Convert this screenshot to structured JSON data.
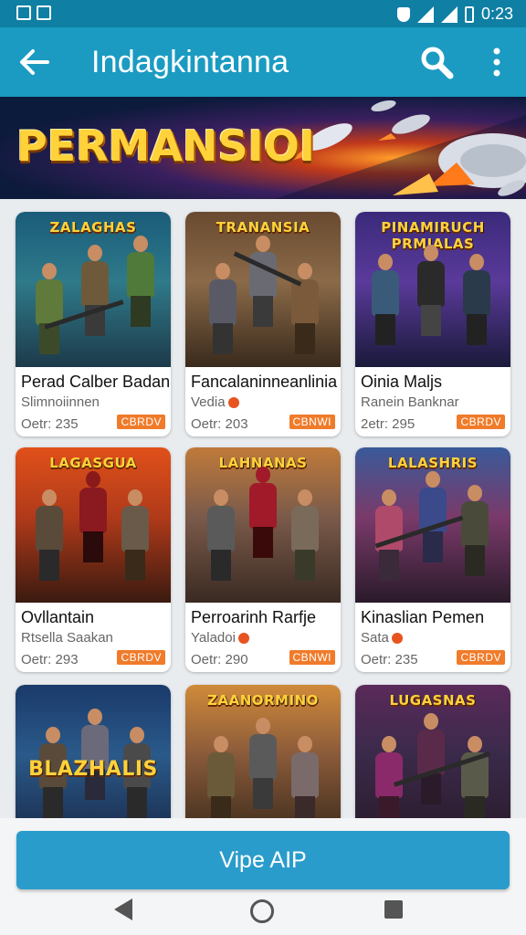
{
  "status": {
    "time": "0:23"
  },
  "appbar": {
    "title": "Indagkintanna",
    "back_icon": "back-arrow-icon",
    "search_icon": "search-icon",
    "more_icon": "more-vert-icon"
  },
  "banner": {
    "text": "PERMANSIOI"
  },
  "colors": {
    "appbar": "#1b9bc2",
    "statusbar": "#0f7fa3",
    "cta": "#2a9ccc",
    "badge": "#f07b2a"
  },
  "cards": [
    {
      "art_title": "ZALAGHAS",
      "name": "Perad Calber Badan",
      "sub": "Slimnoiinnen",
      "sub_dot": false,
      "cost": "Oetr: 235",
      "button": "CBRDV"
    },
    {
      "art_title": "TRANANSIA",
      "name": "Fancalaninneanlinia",
      "sub": "Vedia",
      "sub_dot": true,
      "cost": "Oetr: 203",
      "button": "CBNWI"
    },
    {
      "art_title": "PINAMIRUCH PRMIALAS",
      "name": "Oinia Maljs",
      "sub": "Ranein Banknar",
      "sub_dot": false,
      "cost": "2etr: 295",
      "button": "CBRDV"
    },
    {
      "art_title": "LAGASGUA",
      "name": "Ovllantain",
      "sub": "Rtsella Saakan",
      "sub_dot": false,
      "cost": "Oetr: 293",
      "button": "CBRDV"
    },
    {
      "art_title": "LAHNANAS",
      "name": "Perroarinh Rarfje",
      "sub": "Yaladoi",
      "sub_dot": true,
      "cost": "Oetr: 290",
      "button": "CBNWI"
    },
    {
      "art_title": "LALASHRIS",
      "name": "Kinaslian Pemen",
      "sub": "Sata",
      "sub_dot": true,
      "cost": "Oetr: 235",
      "button": "CBRDV"
    },
    {
      "art_title": "",
      "name": "",
      "sub": "",
      "sub_dot": false,
      "cost": "",
      "button": ""
    },
    {
      "art_title": "ZAANORMINO",
      "name": "",
      "sub": "",
      "sub_dot": false,
      "cost": "",
      "button": ""
    },
    {
      "art_title": "LUGASNAS",
      "name": "",
      "sub": "",
      "sub_dot": false,
      "cost": "",
      "button": ""
    }
  ],
  "art_overlay_7": "BLAZHALIS",
  "cta": {
    "label": "Vipe AIP"
  },
  "nav": {
    "back_icon": "nav-back-icon",
    "home_icon": "nav-home-icon",
    "recents_icon": "nav-recents-icon"
  }
}
